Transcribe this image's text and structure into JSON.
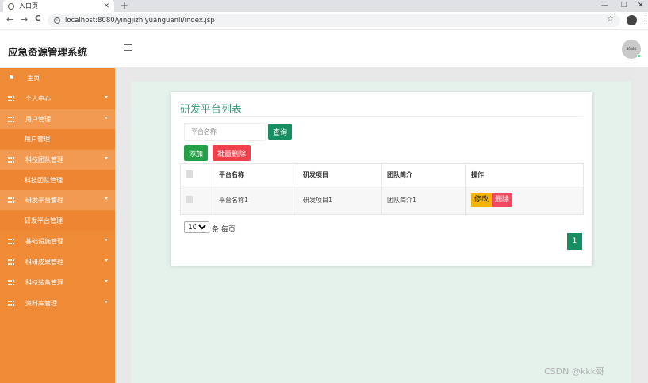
{
  "browser": {
    "tab_title": "入口页",
    "tab_close": "✕",
    "new_tab": "+",
    "url": "localhost:8080/yingjizhiyuanguanli/index.jsp",
    "win_minimize": "—",
    "win_restore": "❐",
    "win_close": "✕",
    "back": "←",
    "forward": "→",
    "reload": "C",
    "info": "i",
    "star": "☆",
    "menu": "⋮"
  },
  "header": {
    "title": "应急资源管理系统",
    "avatar_text": "80x80"
  },
  "sidebar": {
    "items": [
      {
        "label": "主页",
        "type": "flag"
      },
      {
        "label": "个人中心",
        "type": "parent"
      },
      {
        "label": "用户管理",
        "type": "parent-open"
      },
      {
        "label": "用户管理",
        "type": "child"
      },
      {
        "label": "科技团队管理",
        "type": "parent-open"
      },
      {
        "label": "科技团队管理",
        "type": "child"
      },
      {
        "label": "研发平台管理",
        "type": "parent-open"
      },
      {
        "label": "研发平台管理",
        "type": "child"
      },
      {
        "label": "基础设施管理",
        "type": "parent"
      },
      {
        "label": "科研成果管理",
        "type": "parent"
      },
      {
        "label": "科技装备管理",
        "type": "parent"
      },
      {
        "label": "资料库管理",
        "type": "parent"
      }
    ]
  },
  "main": {
    "panel_title": "研发平台列表",
    "search_placeholder": "平台名称",
    "query_button": "查询",
    "add_button": "添加",
    "batch_delete_button": "批量删除",
    "table": {
      "columns": [
        "平台名称",
        "研发项目",
        "团队简介",
        "操作"
      ],
      "rows": [
        {
          "platform": "平台名称1",
          "project": "研发项目1",
          "team": "团队简介1",
          "edit": "修改",
          "delete": "删除"
        }
      ]
    },
    "page_size": "10",
    "page_size_options": [
      "10"
    ],
    "per_page_label": "条 每页",
    "current_page": "1"
  },
  "watermark": "CSDN @kkk哥"
}
